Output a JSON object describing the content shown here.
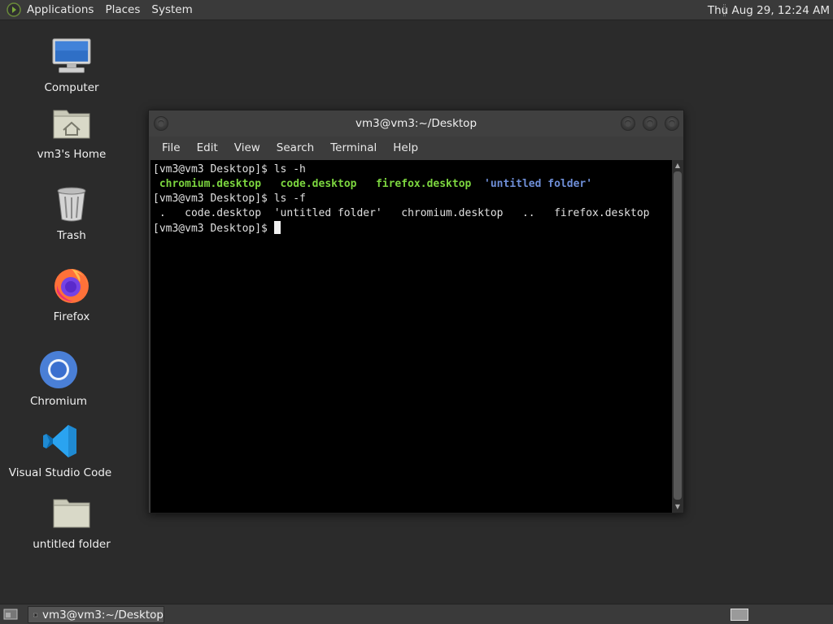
{
  "top_panel": {
    "menus": [
      "Applications",
      "Places",
      "System"
    ],
    "clock": "Thu Aug 29, 12:24 AM"
  },
  "desktop_icons": [
    {
      "label": "Computer",
      "icon": "computer-icon"
    },
    {
      "label": "vm3's Home",
      "icon": "home-folder-icon"
    },
    {
      "label": "Trash",
      "icon": "trash-icon"
    },
    {
      "label": "Firefox",
      "icon": "firefox-icon"
    },
    {
      "label": "Chromium",
      "icon": "chromium-icon"
    },
    {
      "label": "Visual Studio Code",
      "icon": "vscode-icon"
    },
    {
      "label": "untitled folder",
      "icon": "folder-icon"
    }
  ],
  "terminal": {
    "title": "vm3@vm3:~/Desktop",
    "menus": [
      "File",
      "Edit",
      "View",
      "Search",
      "Terminal",
      "Help"
    ],
    "lines": {
      "l1_prompt": "[vm3@vm3 Desktop]$ ",
      "l1_cmd": "ls -h",
      "l2_items": [
        "chromium.desktop",
        "code.desktop",
        "firefox.desktop",
        "'untitled folder'"
      ],
      "l3_prompt": "[vm3@vm3 Desktop]$ ",
      "l3_cmd": "ls -f",
      "l4_text": " .   code.desktop  'untitled folder'   chromium.desktop   ..   firefox.desktop",
      "l5_prompt": "[vm3@vm3 Desktop]$ "
    },
    "colors": {
      "executable": "#7cd63f",
      "directory": "#6f8fd8"
    }
  },
  "bottom_panel": {
    "task_label": "vm3@vm3:~/Desktop"
  }
}
